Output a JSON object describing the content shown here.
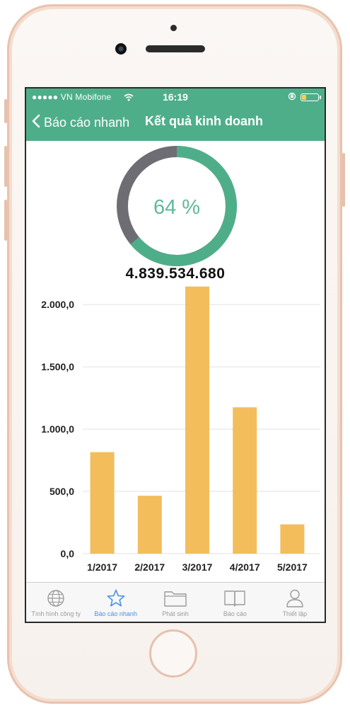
{
  "status": {
    "carrier": "●●●●● VN Mobifone",
    "time": "16:19"
  },
  "nav": {
    "back_label": "Báo cáo nhanh",
    "title": "Kết quả kinh doanh"
  },
  "summary": {
    "percent_label": "64 %",
    "percent": 0.64,
    "total": "4.839.534.680"
  },
  "colors": {
    "accent": "#4fae8a",
    "track": "#6d6d73",
    "bar": "#f3bd5c",
    "tab_active": "#4a8fe2"
  },
  "chart_data": {
    "type": "bar",
    "categories": [
      "1/2017",
      "2/2017",
      "3/2017",
      "4/2017",
      "5/2017"
    ],
    "values": [
      815,
      465,
      2145,
      1175,
      235
    ],
    "ylim": [
      0,
      2200
    ],
    "yticks": [
      "0,0",
      "500,0",
      "1.000,0",
      "1.500,0",
      "2.000,0"
    ],
    "ytick_values": [
      0,
      500,
      1000,
      1500,
      2000
    ],
    "grid": true,
    "title": "",
    "xlabel": "",
    "ylabel": ""
  },
  "tabs": [
    {
      "label": "Tình hình công ty",
      "icon": "globe-icon",
      "active": false
    },
    {
      "label": "Báo cáo nhanh",
      "icon": "star-icon",
      "active": true
    },
    {
      "label": "Phát sinh",
      "icon": "folder-icon",
      "active": false
    },
    {
      "label": "Báo cáo",
      "icon": "book-icon",
      "active": false
    },
    {
      "label": "Thiết lập",
      "icon": "person-icon",
      "active": false
    }
  ]
}
